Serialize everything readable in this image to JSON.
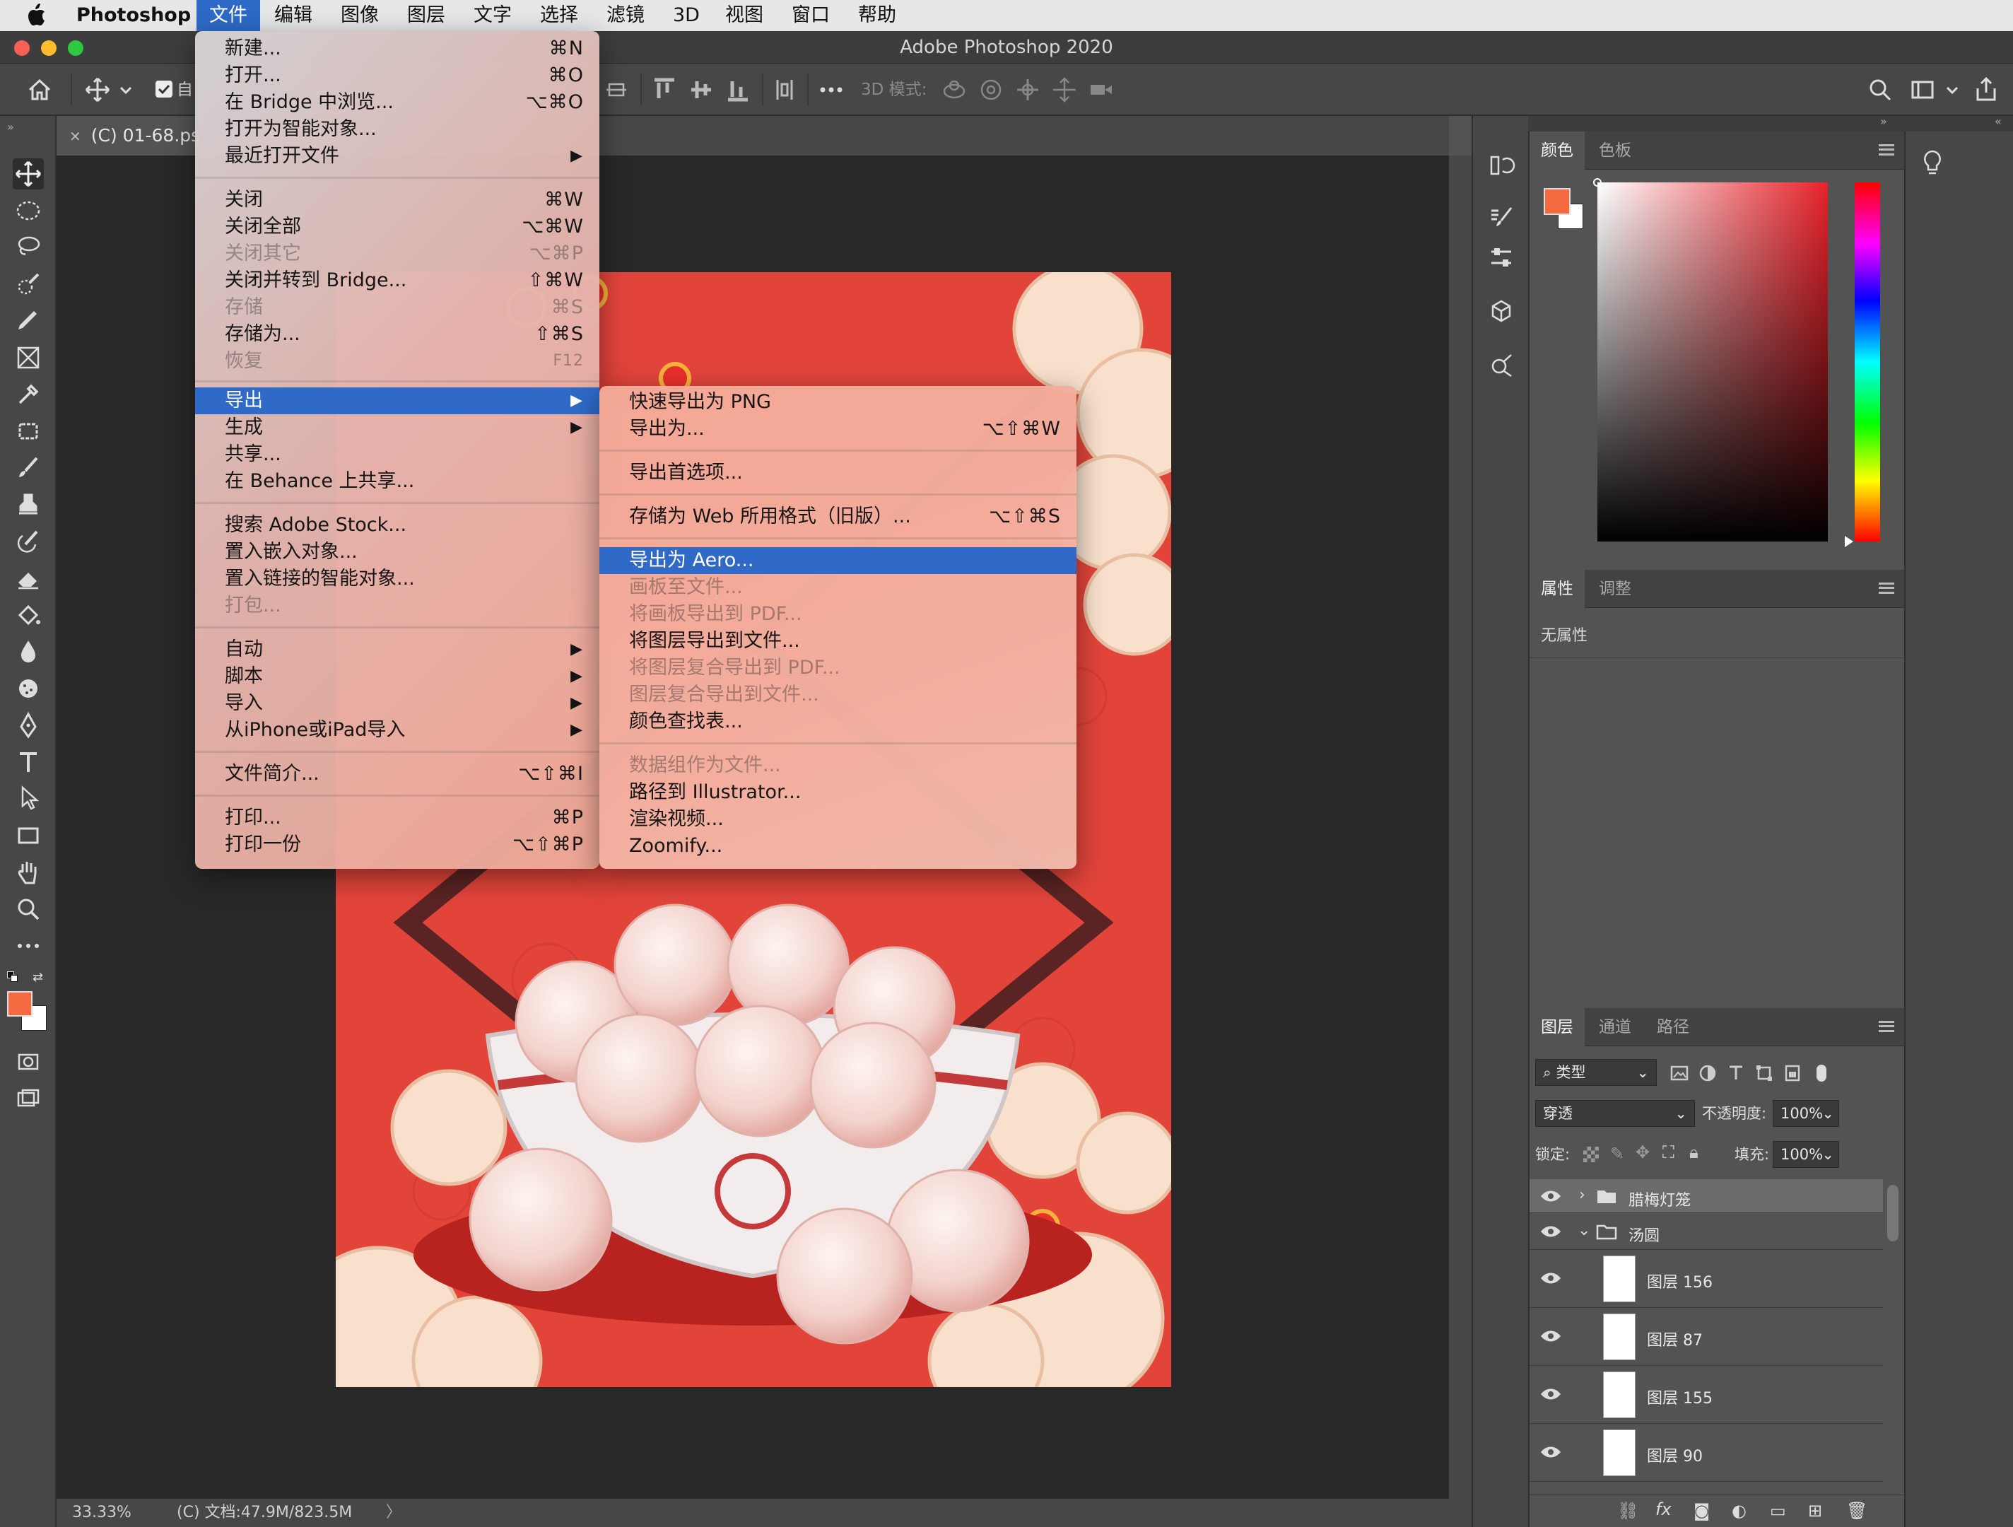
{
  "menubar": {
    "app": "Photoshop",
    "items": [
      "文件",
      "编辑",
      "图像",
      "图层",
      "文字",
      "选择",
      "滤镜",
      "3D",
      "视图",
      "窗口",
      "帮助"
    ],
    "active_index": 0
  },
  "window": {
    "title": "Adobe Photoshop 2020"
  },
  "options_bar": {
    "auto_select_label": "自",
    "mode_3d_label": "3D 模式:"
  },
  "document": {
    "tab_label": "(C) 01-68.ps",
    "zoom": "33.33%",
    "doc_info": "(C) 文档:47.9M/823.5M"
  },
  "file_menu": {
    "items": [
      {
        "label": "新建...",
        "shortcut": "⌘N"
      },
      {
        "label": "打开...",
        "shortcut": "⌘O"
      },
      {
        "label": "在 Bridge 中浏览...",
        "shortcut": "⌥⌘O"
      },
      {
        "label": "打开为智能对象...",
        "shortcut": ""
      },
      {
        "label": "最近打开文件",
        "shortcut": "",
        "submenu": true
      },
      {
        "label": "关闭",
        "shortcut": "⌘W"
      },
      {
        "label": "关闭全部",
        "shortcut": "⌥⌘W"
      },
      {
        "label": "关闭其它",
        "shortcut": "⌥⌘P",
        "disabled": true
      },
      {
        "label": "关闭并转到 Bridge...",
        "shortcut": "⇧⌘W"
      },
      {
        "label": "存储",
        "shortcut": "⌘S",
        "disabled": true
      },
      {
        "label": "存储为...",
        "shortcut": "⇧⌘S"
      },
      {
        "label": "恢复",
        "shortcut": "F12",
        "disabled": true
      },
      {
        "label": "导出",
        "shortcut": "",
        "submenu": true,
        "highlighted": true
      },
      {
        "label": "生成",
        "shortcut": "",
        "submenu": true
      },
      {
        "label": "共享...",
        "shortcut": ""
      },
      {
        "label": "在 Behance 上共享...",
        "shortcut": ""
      },
      {
        "label": "搜索 Adobe Stock...",
        "shortcut": ""
      },
      {
        "label": "置入嵌入对象...",
        "shortcut": ""
      },
      {
        "label": "置入链接的智能对象...",
        "shortcut": ""
      },
      {
        "label": "打包...",
        "shortcut": "",
        "disabled": true
      },
      {
        "label": "自动",
        "shortcut": "",
        "submenu": true
      },
      {
        "label": "脚本",
        "shortcut": "",
        "submenu": true
      },
      {
        "label": "导入",
        "shortcut": "",
        "submenu": true
      },
      {
        "label": "从iPhone或iPad导入",
        "shortcut": "",
        "submenu": true
      },
      {
        "label": "文件简介...",
        "shortcut": "⌥⇧⌘I"
      },
      {
        "label": "打印...",
        "shortcut": "⌘P"
      },
      {
        "label": "打印一份",
        "shortcut": "⌥⇧⌘P"
      }
    ]
  },
  "export_menu": {
    "items": [
      {
        "label": "快速导出为 PNG",
        "shortcut": ""
      },
      {
        "label": "导出为...",
        "shortcut": "⌥⇧⌘W"
      },
      {
        "label": "导出首选项...",
        "shortcut": ""
      },
      {
        "label": "存储为 Web 所用格式（旧版）...",
        "shortcut": "⌥⇧⌘S"
      },
      {
        "label": "导出为 Aero...",
        "shortcut": "",
        "highlighted": true
      },
      {
        "label": "画板至文件...",
        "shortcut": "",
        "disabled": true
      },
      {
        "label": "将画板导出到 PDF...",
        "shortcut": "",
        "disabled": true
      },
      {
        "label": "将图层导出到文件...",
        "shortcut": ""
      },
      {
        "label": "将图层复合导出到 PDF...",
        "shortcut": "",
        "disabled": true
      },
      {
        "label": "图层复合导出到文件...",
        "shortcut": "",
        "disabled": true
      },
      {
        "label": "颜色查找表...",
        "shortcut": ""
      },
      {
        "label": "数据组作为文件...",
        "shortcut": "",
        "disabled": true
      },
      {
        "label": "路径到 Illustrator...",
        "shortcut": ""
      },
      {
        "label": "渲染视频...",
        "shortcut": ""
      },
      {
        "label": "Zoomify...",
        "shortcut": ""
      }
    ]
  },
  "color_panel": {
    "tabs": [
      "颜色",
      "色板"
    ],
    "foreground": "#f26a3e",
    "background": "#ffffff"
  },
  "properties_panel": {
    "tabs": [
      "属性",
      "调整"
    ],
    "empty_text": "无属性"
  },
  "layers_panel": {
    "tabs": [
      "图层",
      "通道",
      "路径"
    ],
    "filter_label": "类型",
    "blend_mode": "穿透",
    "opacity_label": "不透明度:",
    "opacity_value": "100%",
    "lock_label": "锁定:",
    "fill_label": "填充:",
    "fill_value": "100%",
    "layers": [
      {
        "name": "腊梅灯笼",
        "type": "group",
        "expanded": false
      },
      {
        "name": "汤圆",
        "type": "group",
        "expanded": true
      },
      {
        "name": "图层 156",
        "type": "layer"
      },
      {
        "name": "图层 87",
        "type": "layer"
      },
      {
        "name": "图层 155",
        "type": "layer"
      },
      {
        "name": "图层 90",
        "type": "layer"
      }
    ]
  },
  "colors": {
    "menu_highlight": "#2f6ac8",
    "artwork_red": "#e2443a",
    "panel_bg": "#535353"
  }
}
